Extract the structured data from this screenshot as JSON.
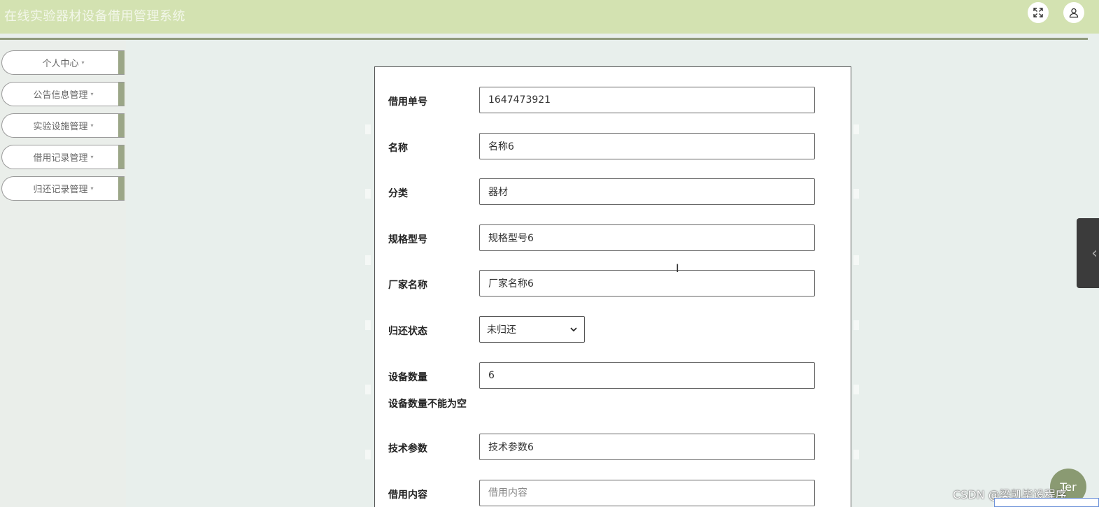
{
  "header": {
    "title": "在线实验器材设备借用管理系统",
    "icons": [
      "fullscreen-icon",
      "user-icon"
    ]
  },
  "sidebar": {
    "items": [
      {
        "label": "个人中心"
      },
      {
        "label": "公告信息管理"
      },
      {
        "label": "实验设施管理"
      },
      {
        "label": "借用记录管理"
      },
      {
        "label": "归还记录管理"
      }
    ],
    "caret": "▾"
  },
  "form": {
    "fields": [
      {
        "label": "借用单号",
        "value": "1647473921"
      },
      {
        "label": "名称",
        "value": "名称6"
      },
      {
        "label": "分类",
        "value": "器材"
      },
      {
        "label": "规格型号",
        "value": "规格型号6"
      },
      {
        "label": "厂家名称",
        "value": "厂家名称6"
      }
    ],
    "return_status": {
      "label": "归还状态",
      "selected": "未归还"
    },
    "quantity": {
      "label": "设备数量",
      "value": "6",
      "error": "设备数量不能为空"
    },
    "tech_params": {
      "label": "技术参数",
      "value": "技术参数6"
    },
    "borrow_content": {
      "label": "借用内容",
      "placeholder": "借用内容"
    }
  },
  "overlay": {
    "fab_text": "Ter",
    "watermark": "CSDN @梁凯毕设程序"
  },
  "colors": {
    "header_bg": "#d3e2b1",
    "accent": "#9ba687",
    "page_bg": "#e8efec"
  }
}
